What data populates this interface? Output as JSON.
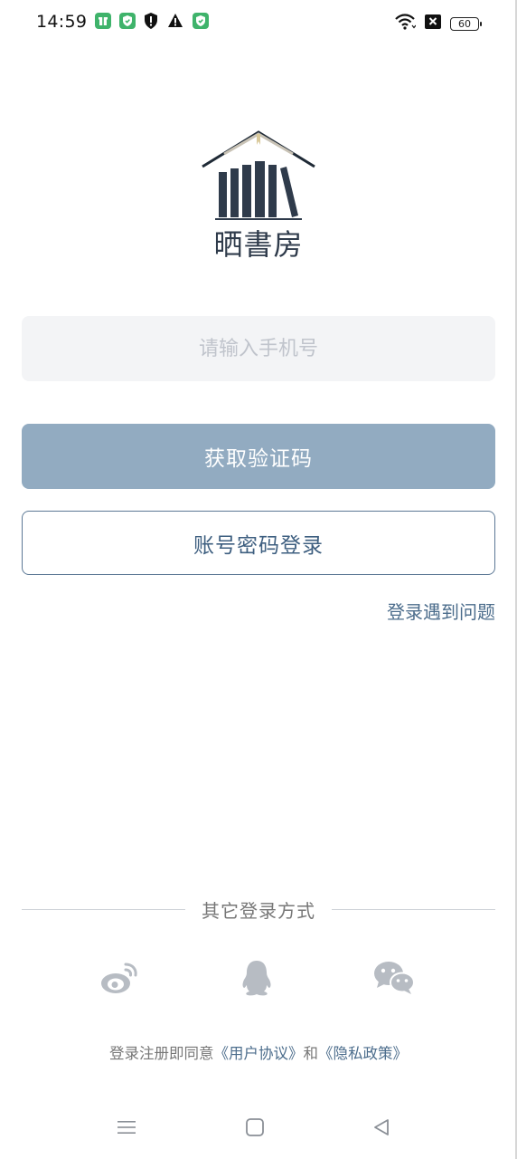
{
  "status_bar": {
    "time": "14:59",
    "battery": "60",
    "icons": [
      "gift-app-icon",
      "shield-app-icon",
      "alert-shield-icon",
      "warning-icon",
      "shield-app-icon",
      "wifi-icon",
      "sim-off-icon",
      "battery-icon"
    ]
  },
  "brand": {
    "name": "晒書房"
  },
  "login": {
    "phone_placeholder": "请输入手机号",
    "phone_value": "",
    "get_code_label": "获取验证码",
    "password_login_label": "账号密码登录",
    "help_link": "登录遇到问题"
  },
  "other_login": {
    "label": "其它登录方式",
    "providers": [
      "weibo-icon",
      "qq-icon",
      "wechat-icon"
    ]
  },
  "agreement": {
    "prefix": "登录注册即同意",
    "user_agreement": "《用户协议》",
    "conjunction": "和",
    "privacy_policy": "《隐私政策》"
  },
  "colors": {
    "primary_button": "#92abc1",
    "accent_text": "#4c6d8c",
    "input_bg": "#f3f4f6"
  }
}
